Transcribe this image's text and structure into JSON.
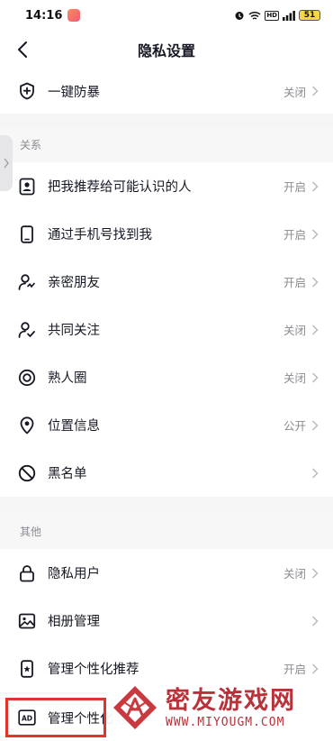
{
  "status_bar": {
    "time": "14:16",
    "battery": "51"
  },
  "nav": {
    "title": "隐私设置"
  },
  "top_item": {
    "label": "一键防暴",
    "value": "关闭",
    "icon": "shield-plus-icon"
  },
  "section_relations": {
    "header": "关系",
    "items": [
      {
        "label": "把我推荐给可能认识的人",
        "value": "开启",
        "icon": "contact-card-icon"
      },
      {
        "label": "通过手机号找到我",
        "value": "开启",
        "icon": "phone-icon"
      },
      {
        "label": "亲密朋友",
        "value": "开启",
        "icon": "close-friend-icon"
      },
      {
        "label": "共同关注",
        "value": "关闭",
        "icon": "mutual-follow-icon"
      },
      {
        "label": "熟人圈",
        "value": "关闭",
        "icon": "circle-icon"
      },
      {
        "label": "位置信息",
        "value": "公开",
        "icon": "location-pin-icon"
      },
      {
        "label": "黑名单",
        "value": "",
        "icon": "block-icon"
      }
    ]
  },
  "section_other": {
    "header": "其他",
    "items": [
      {
        "label": "隐私用户",
        "value": "关闭",
        "icon": "lock-icon"
      },
      {
        "label": "相册管理",
        "value": "",
        "icon": "photo-icon"
      },
      {
        "label": "管理个性化推荐",
        "value": "开启",
        "icon": "phone-star-icon"
      },
      {
        "label": "管理个性化",
        "value": "",
        "icon": "ad-icon"
      }
    ]
  },
  "watermark": {
    "name": "密友游戏网",
    "url": "WWW.MIYOUGM.COM"
  },
  "colors": {
    "text": "#161823",
    "secondary": "#8a8b91",
    "background": "#f5f5f6",
    "highlight": "#e0342f",
    "watermark": "#b8323a"
  }
}
